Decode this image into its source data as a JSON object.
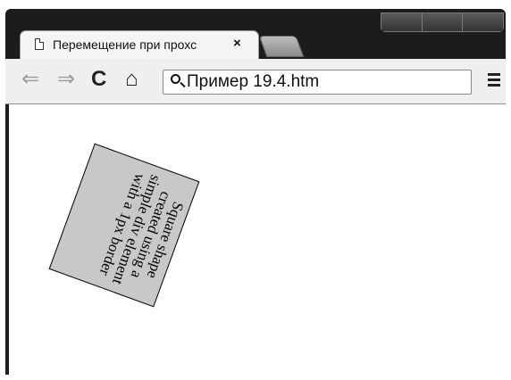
{
  "tab": {
    "title": "Перемещение при прохс",
    "close": "×"
  },
  "toolbar": {
    "back": "⇐",
    "forward": "⇒",
    "reload": "C",
    "home": "⌂",
    "address": "Пример 19.4.htm"
  },
  "content": {
    "square_text": "Square shape created using a simple div element with a 1px border"
  },
  "colors": {
    "square_fill": "#c8c8c8",
    "frame": "#1c1c1c"
  }
}
